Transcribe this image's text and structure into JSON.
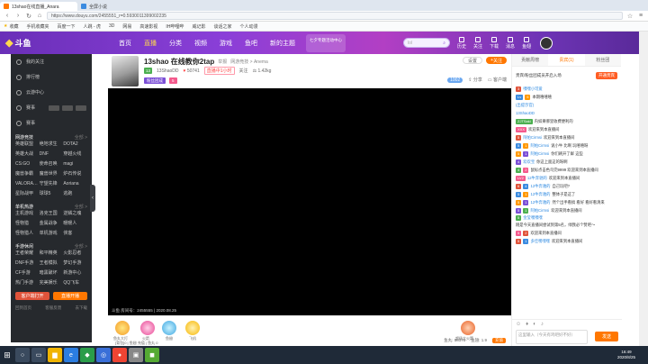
{
  "browser": {
    "tabs": [
      {
        "title": "13shao在线直播_Anara",
        "active": true
      },
      {
        "title": "全屏小说",
        "active": false
      }
    ],
    "url": "https://www.douyu.com/2455551_r=0.5930011399002235",
    "bookmarks": [
      "收藏",
      "手机收藏夹",
      "百度一下",
      "人跳 - 虎",
      "3D",
      "网易",
      "高速影视",
      "IH哔哩哔",
      "威记影",
      "谈话之家",
      "个人动漫"
    ]
  },
  "header": {
    "logo": "斗鱼",
    "nav": [
      "首页",
      "直播",
      "分类",
      "视频",
      "游戏",
      "鱼吧",
      "新的主题"
    ],
    "nav_active": "直播",
    "promo": "七夕专题活动中心",
    "search_placeholder": "lol",
    "icons": [
      "历史",
      "关注",
      "下载",
      "消息",
      "鱼翅"
    ]
  },
  "sidebar": {
    "top_items": [
      "我的关注",
      "排行榜",
      "云游中心",
      "赛事",
      "赛事"
    ],
    "sections": [
      {
        "title": "网游竞技",
        "more": "全部 >",
        "items": [
          "英雄联盟",
          "绝地求生",
          "DOTA2",
          "英雄大战",
          "DNF",
          "穿越火线",
          "CS:GO",
          "使命召唤",
          "magi",
          "魔兽争霸",
          "魔兽世界",
          "炉石传说",
          "VALORA…",
          "守望先锋",
          "Aoriana",
          "星际战甲",
          "球球5",
          "逃跑"
        ]
      },
      {
        "title": "单机热游",
        "more": "全部 >",
        "items": [
          "主机游戏",
          "洛克王国",
          "逆鳞之魂",
          "怪物猎",
          "金属战争",
          "暖暖人",
          "怪物猎人",
          "单机游戏",
          "侠客"
        ]
      },
      {
        "title": "手游休闲",
        "more": "全部 >",
        "items": [
          "王者荣耀",
          "和平精英",
          "火影忍者",
          "DNF手游",
          "王者模拟",
          "梦幻手游",
          "CF手游",
          "暗黑破坏",
          "新游中心",
          "热门手游",
          "完美娱乐",
          "QQ飞车"
        ]
      }
    ],
    "btn_left": "客户端打开",
    "btn_right": "直播开播",
    "footer": [
      "回到首页",
      "客服反馈",
      "去下载",
      "斗鱼下载"
    ]
  },
  "anchor": {
    "title": "13shao 在线教你2tap",
    "title_tag": "举报",
    "category": "网游竞技 > Anema",
    "level_chip": "13",
    "name": "13ShaoDD",
    "fans": "50741",
    "status": "直播中1小时",
    "follow": "关注",
    "weight": "1.42kg",
    "badge": "粉丝团成",
    "badge_level": "5",
    "btn_report": "设置",
    "btn_follow": "关注",
    "share": "分享",
    "download": "客户端",
    "fans_badge": "1002"
  },
  "video": {
    "caption": "斗鱼 房间号：2455555 | 2020.08.25"
  },
  "gift_bar": {
    "gifts": [
      "鱼丸大打",
      "火箭",
      "鱼翅",
      "飞机",
      "超级大火箭"
    ],
    "subtext": "[背包]0 | 鱼翅 充值 | 鱼丸 0",
    "stats": [
      "鱼丸: 58178",
      "鱼翅: 1.9"
    ],
    "btn": "充值"
  },
  "chat": {
    "tabs": [
      "贡献周榜",
      "贵宾(1)",
      "粉丝团"
    ],
    "active_tab": "贵宾(1)",
    "notice": "贵宾/粉丝团成员开启入场",
    "notice_btn": "开通贵宾",
    "messages": [
      {
        "badges": [
          "3"
        ],
        "user": "嘿嘿小可爱",
        "text": ""
      },
      {
        "badges": [
          "Lv",
          "5"
        ],
        "user": "",
        "text": "本期嘻嘻嘻"
      },
      {
        "badges": [],
        "user": "(出提示官)",
        "text": ""
      },
      {
        "badges": [],
        "user": "13ShaoDD",
        "text": ""
      },
      {
        "badges": [
          "ZJTSaki"
        ],
        "user": "",
        "text": "内如果哪里收费便利的"
      },
      {
        "badges": [
          "XXX"
        ],
        "user": "",
        "text": "欢迎来到本直播间"
      },
      {
        "badges": [
          "5"
        ],
        "user": "阿帕Cirmsi",
        "text": "欢迎来到本直播间"
      },
      {
        "badges": [
          "5",
          "1"
        ],
        "user": "阿帕Cirmsi",
        "text": "说小牛 比啊 玩嘻嘻呀"
      },
      {
        "badges": [
          "5",
          "1"
        ],
        "user": "阿帕Cirmsi",
        "text": "你们刷开了鲜 这些"
      },
      {
        "badges": [
          "4"
        ],
        "user": "欢欢宝",
        "text": "你这上面这的呀啊"
      },
      {
        "badges": [
          "4",
          "2"
        ],
        "user": "",
        "text": "鼠标点击色鸟完9999 欢迎来到本直播间"
      },
      {
        "badges": [
          "LV2"
        ],
        "user": "12牛奔驰的",
        "text": "欢迎来到本直播间"
      },
      {
        "badges": [
          "6",
          "4"
        ],
        "user": "12牛奔驰的",
        "text": "自己玩吧?"
      },
      {
        "badges": [
          "5",
          "1"
        ],
        "user": "12牛奔驰的",
        "text": "整体子是这了"
      },
      {
        "badges": [
          "5",
          "1"
        ],
        "user": "12牛奔驰的",
        "text": "然个出手看搞 看好 看好看清来"
      },
      {
        "badges": [
          "5",
          "1"
        ],
        "user": "阿帕Cirmsi",
        "text": "欢迎来到本直播间"
      },
      {
        "badges": [
          "5"
        ],
        "user": "金莹嘿嘿嘿",
        "text": "刚是今天直播间尝试到第5名，绿我必个赞吧～"
      },
      {
        "badges": [
          "5",
          "2"
        ],
        "user": "",
        "text": "欢迎来到本直播间"
      },
      {
        "badges": [
          "5",
          "1"
        ],
        "user": "多佳嘿嘿嘿",
        "text": "欢迎来到本直播间"
      }
    ],
    "input_placeholder": "这里输入（今天有鸡吧好不好）",
    "send": "发送"
  },
  "taskbar": {
    "time": "16:49",
    "date": "2020/8/25"
  }
}
